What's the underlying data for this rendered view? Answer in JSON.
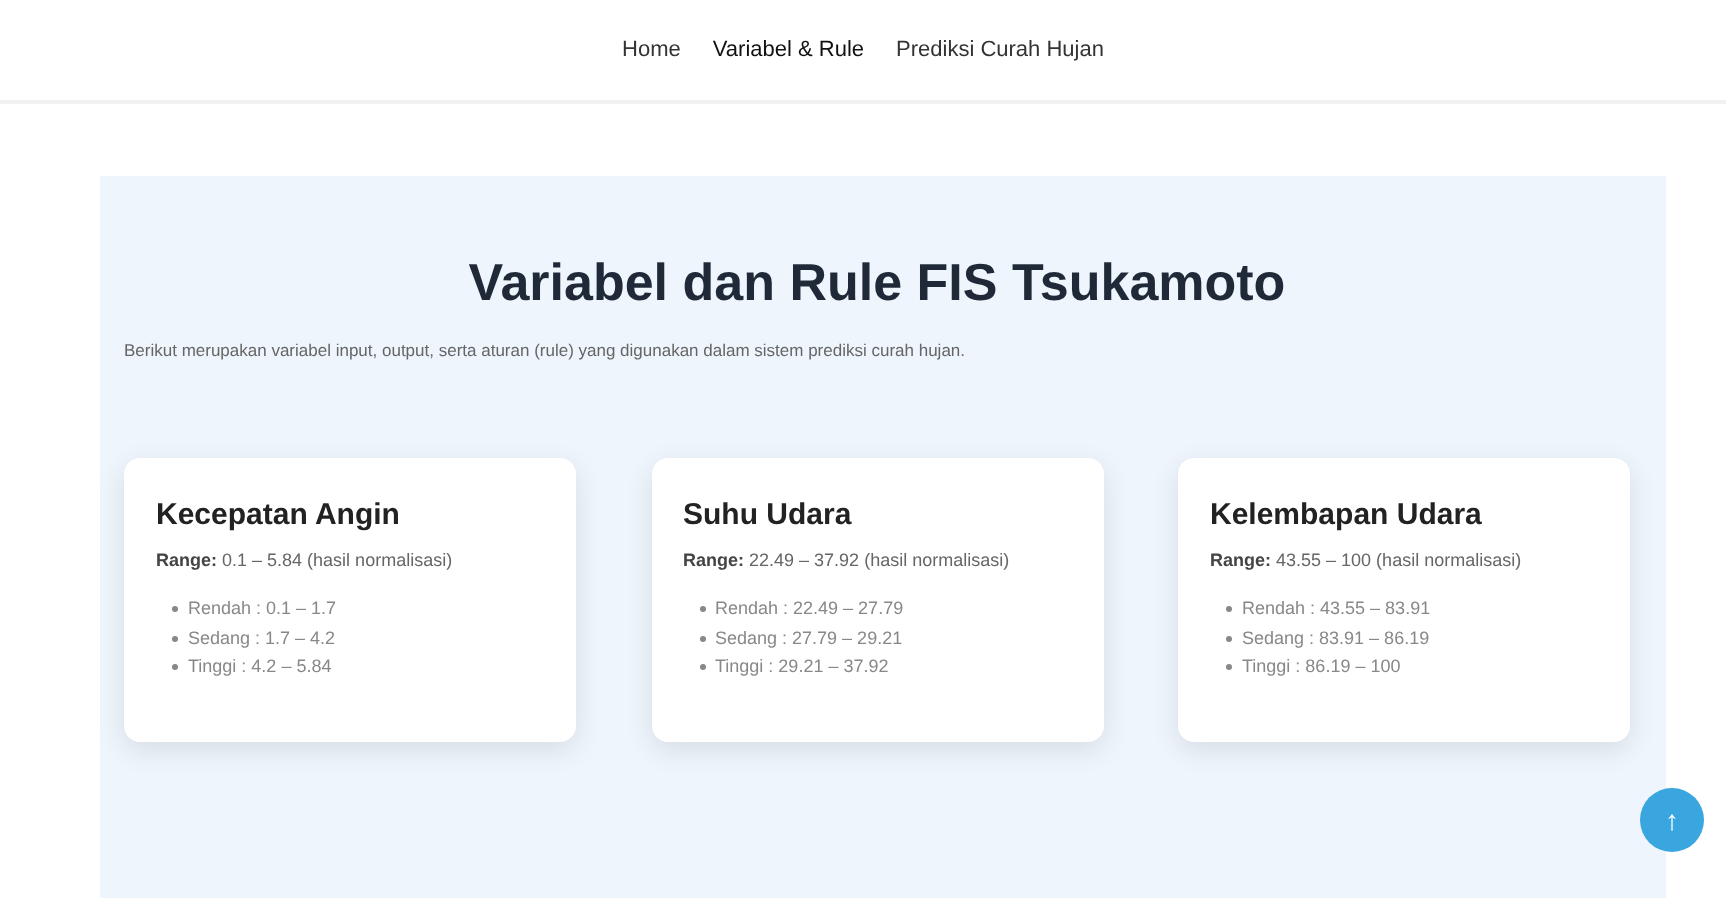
{
  "nav": [
    {
      "label": "Home",
      "selected": false
    },
    {
      "label": "Variabel & Rule",
      "selected": true
    },
    {
      "label": "Prediksi Curah Hujan",
      "selected": false
    }
  ],
  "title": "Variabel dan Rule FIS Tsukamoto",
  "intro": "Berikut merupakan variabel input, output, serta aturan (rule) yang digunakan dalam sistem prediksi curah hujan.",
  "cards": [
    {
      "title": "Kecepatan Angin",
      "range": "**Range:** 0.1 – 5.84 (hasil normalisasi)",
      "items": [
        "Rendah : 0.1 – 1.7",
        "Sedang : 1.7 – 4.2",
        "Tinggi : 4.2 – 5.84"
      ]
    },
    {
      "title": "Suhu Udara",
      "range": "**Range:** 22.49 – 37.92 (hasil normalisasi)",
      "items": [
        "Rendah : 22.49 – 27.79",
        "Sedang : 27.79 – 29.21",
        "Tinggi : 29.21 – 37.92"
      ]
    },
    {
      "title": "Kelembapan Udara",
      "range": "**Range:** 43.55 – 100 (hasil normalisasi)",
      "items": [
        "Rendah : 43.55 – 83.91",
        "Sedang : 83.91 – 86.19",
        "Tinggi : 86.19 – 100"
      ]
    }
  ],
  "scroll_top": "↑"
}
